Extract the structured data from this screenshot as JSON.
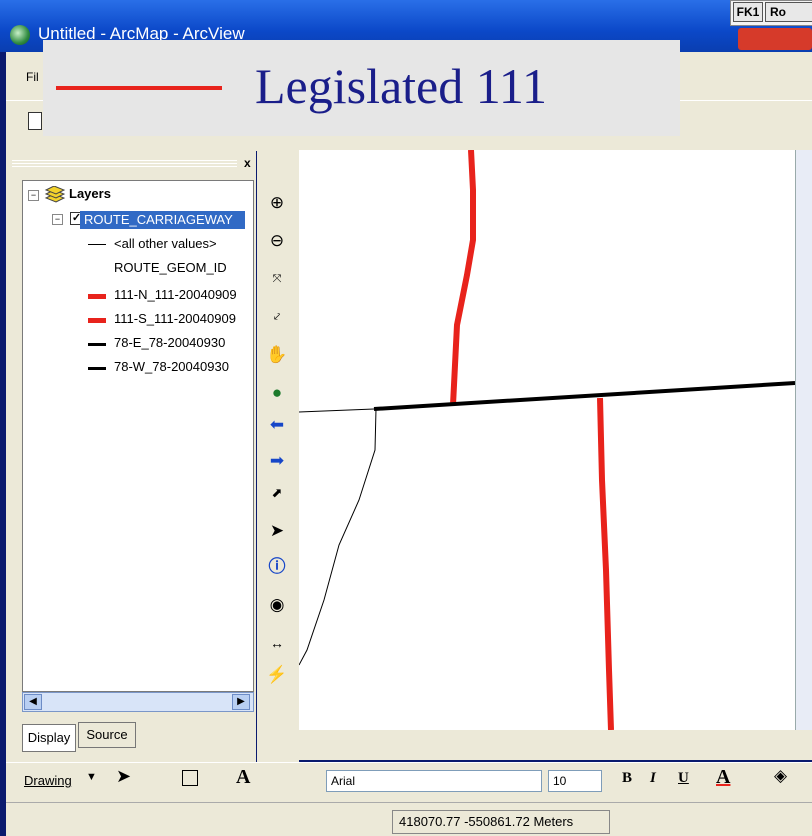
{
  "window": {
    "title": "Untitled - ArcMap - ArcView",
    "fk_label": "FK1",
    "ro_label": "Ro"
  },
  "menu": {
    "file_label": "Fil"
  },
  "overlay_legend": {
    "label": "Legislated 111",
    "swatch_color": "#e8231c",
    "text_color": "#1a1e8a"
  },
  "toc": {
    "close_label": "x",
    "root_label": "Layers",
    "layer_label": "ROUTE_CARRIAGEWAY",
    "field_label": "ROUTE_GEOM_ID",
    "items": [
      {
        "label": "<all other values>",
        "color": "#000000"
      },
      {
        "label": "111-N_111-20040909",
        "color": "#e8231c"
      },
      {
        "label": "111-S_111-20040909",
        "color": "#e8231c"
      },
      {
        "label": "78-E_78-20040930",
        "color": "#000000"
      },
      {
        "label": "78-W_78-20040930",
        "color": "#000000"
      }
    ],
    "tabs": {
      "display": "Display",
      "source": "Source"
    }
  },
  "tools": [
    "zoom-in-icon",
    "zoom-out-icon",
    "fixed-zoom-in-icon",
    "fixed-zoom-out-icon",
    "pan-icon",
    "full-extent-icon",
    "back-icon",
    "forward-icon",
    "select-features-icon",
    "select-elements-icon",
    "identify-icon",
    "find-icon",
    "measure-icon",
    "hyperlink-icon"
  ],
  "drawing": {
    "menu_label": "Drawing",
    "font_name": "Arial",
    "font_size": "10",
    "bold": "B",
    "italic": "I",
    "underline": "U",
    "font_color_label": "A"
  },
  "status": {
    "coordinates": "418070.77  -550861.72 Meters"
  }
}
